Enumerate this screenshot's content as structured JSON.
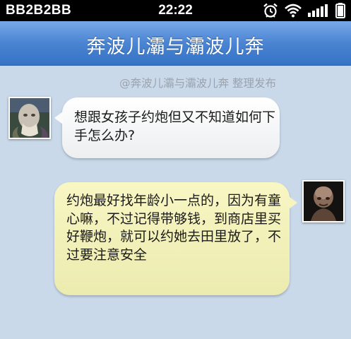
{
  "status_bar": {
    "carrier": "BB2B2BB",
    "time": "22:22",
    "icons": [
      "alarm-icon",
      "wifi-icon",
      "signal-bars-icon",
      "battery-icon"
    ]
  },
  "header": {
    "title": "奔波儿灞与灞波儿奔"
  },
  "watermark": "@奔波儿灞与灞波儿奔 整理发布",
  "messages": [
    {
      "side": "left",
      "avatar": "avatar-icon",
      "text": "想跟女孩子约炮但又不知道如何下手怎么办?"
    },
    {
      "side": "right",
      "avatar": "avatar-icon",
      "text": "约炮最好找年龄小一点的，因为有童心嘛，不过记得带够钱，到商店里买好鞭炮，就可以约她去田里放了，不过要注意安全"
    }
  ],
  "colors": {
    "background": "#c9d9ea",
    "header": "#4a84d2",
    "incoming_bubble": "#ffffff",
    "outgoing_bubble": "#f4f2bd"
  }
}
